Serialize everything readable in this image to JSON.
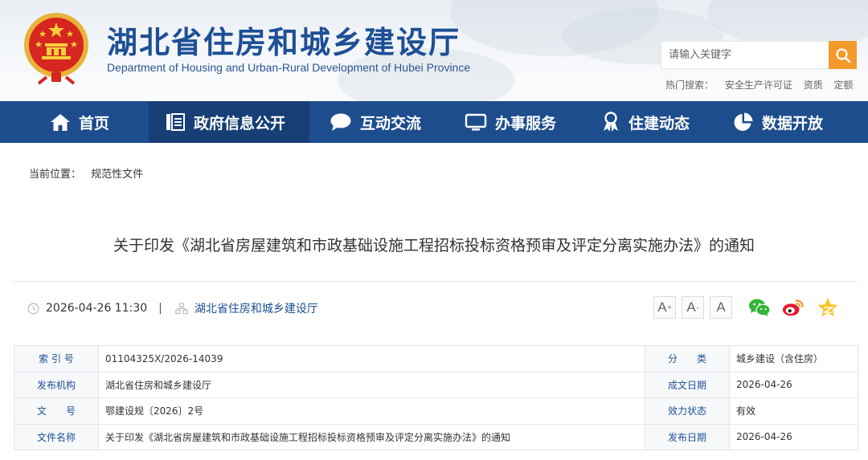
{
  "site": {
    "title": "湖北省住房和城乡建设厅",
    "subtitle": "Department of Housing and Urban-Rural Development of Hubei Province",
    "emblem_icon": "national-emblem"
  },
  "search": {
    "placeholder": "请输入关键字",
    "button_icon": "search-icon",
    "accent": "#f39a2b"
  },
  "hot_search": {
    "label": "热门搜索：",
    "items": [
      "安全生产许可证",
      "资质",
      "定额"
    ]
  },
  "nav": {
    "bg_color": "#1d4d8d",
    "active_color": "#173f75",
    "items": [
      {
        "label": "首页",
        "icon": "home-icon"
      },
      {
        "label": "政府信息公开",
        "icon": "document-list-icon",
        "active": true
      },
      {
        "label": "互动交流",
        "icon": "chat-bubble-icon"
      },
      {
        "label": "办事服务",
        "icon": "monitor-icon"
      },
      {
        "label": "住建动态",
        "icon": "award-icon"
      },
      {
        "label": "数据开放",
        "icon": "pie-chart-icon"
      }
    ]
  },
  "breadcrumb": {
    "label": "当前位置：",
    "items": [
      "规范性文件"
    ]
  },
  "article": {
    "title": "关于印发《湖北省房屋建筑和市政基础设施工程招标投标资格预审及评定分离实施办法》的通知",
    "datetime": "2026-04-26 11:30",
    "divider": "|",
    "source": "湖北省住房和城乡建设厅",
    "font_controls": [
      {
        "label": "A",
        "mark": "+"
      },
      {
        "label": "A",
        "mark": "-"
      },
      {
        "label": "A",
        "mark": ""
      }
    ],
    "share": [
      "wechat-icon",
      "weibo-icon",
      "qzone-icon"
    ]
  },
  "info_table": {
    "label_color": "#1d4f95",
    "rows": [
      {
        "label1": "索 引 号",
        "value1": "01104325X/2026-14039",
        "label2": "分　　类",
        "value2": "城乡建设（含住房）"
      },
      {
        "label1": "发布机构",
        "value1": "湖北省住房和城乡建设厅",
        "label2": "成文日期",
        "value2": "2026-04-26"
      },
      {
        "label1": "文　　号",
        "value1": "鄂建设规〔2026〕2号",
        "label2": "效力状态",
        "value2": "有效"
      },
      {
        "label1": "文件名称",
        "value1": "关于印发《湖北省房屋建筑和市政基础设施工程招标投标资格预审及评定分离实施办法》的通知",
        "label2": "发布日期",
        "value2": "2026-04-26"
      }
    ]
  }
}
